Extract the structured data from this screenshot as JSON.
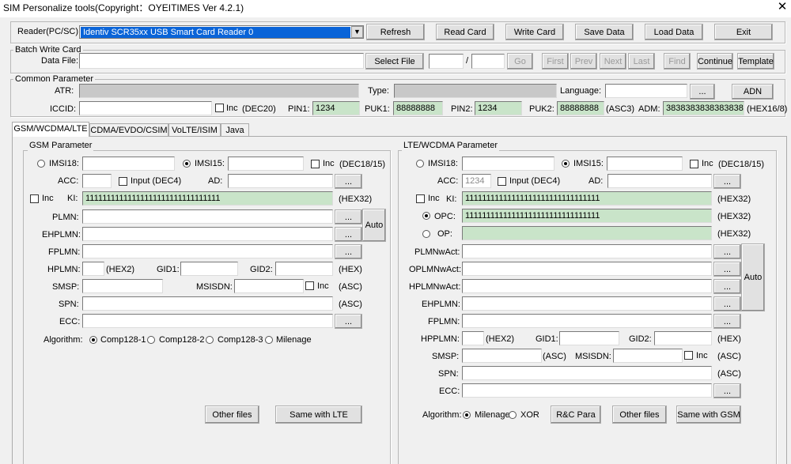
{
  "window": {
    "title": "SIM Personalize tools(Copyright：OYEITIMES Ver 4.2.1)",
    "close_glyph": "✕"
  },
  "reader": {
    "label": "Reader(PC/SC):",
    "selected": "Identiv SCR35xx USB Smart Card Reader 0",
    "dropdown_glyph": "▼"
  },
  "toolbar": {
    "refresh": "Refresh",
    "read_card": "Read Card",
    "write_card": "Write Card",
    "save_data": "Save Data",
    "load_data": "Load Data",
    "exit": "Exit"
  },
  "batch": {
    "group_label": "Batch Write Card",
    "data_file_label": "Data File:",
    "data_file_value": "",
    "select_file": "Select File",
    "page_current": "",
    "page_sep": "/",
    "page_total": "",
    "go": "Go",
    "first": "First",
    "prev": "Prev",
    "next": "Next",
    "last": "Last",
    "find": "Find",
    "continue": "Continue",
    "template": "Template"
  },
  "common": {
    "group_label": "Common Parameter",
    "atr_label": "ATR:",
    "atr_value": "",
    "type_label": "Type:",
    "type_value": "",
    "language_label": "Language:",
    "language_value": "",
    "ellipsis": "...",
    "adn": "ADN",
    "iccid_label": "ICCID:",
    "iccid_value": "",
    "inc_label": "Inc",
    "dec20": "(DEC20)",
    "pin1_label": "PIN1:",
    "pin1_value": "1234",
    "puk1_label": "PUK1:",
    "puk1_value": "88888888",
    "pin2_label": "PIN2:",
    "pin2_value": "1234",
    "puk2_label": "PUK2:",
    "puk2_value": "88888888",
    "asc3": "(ASC3)",
    "adm_label": "ADM:",
    "adm_value": "3838383838383838",
    "hex16_8": "(HEX16/8)"
  },
  "tabs": [
    "GSM/WCDMA/LTE",
    "CDMA/EVDO/CSIM",
    "VoLTE/ISIM",
    "Java"
  ],
  "gsm": {
    "group_label": "GSM Parameter",
    "imsi18_label": "IMSI18:",
    "imsi18_value": "",
    "imsi15_label": "IMSI15:",
    "imsi15_value": "",
    "inc": "Inc",
    "dec18_15": "(DEC18/15)",
    "acc_label": "ACC:",
    "acc_value": "",
    "input_dec4": "Input (DEC4)",
    "ad_label": "AD:",
    "ad_value": "",
    "ki_label": "KI:",
    "ki_value": "11111111111111111111111111111111",
    "hex32": "(HEX32)",
    "plmn_label": "PLMN:",
    "ehplmn_label": "EHPLMN:",
    "fplmn_label": "FPLMN:",
    "auto": "Auto",
    "hplmn_label": "HPLMN:",
    "hex2": "(HEX2)",
    "gid1_label": "GID1:",
    "gid2_label": "GID2:",
    "hex": "(HEX)",
    "smsp_label": "SMSP:",
    "msisdn_label": "MSISDN:",
    "asc": "(ASC)",
    "spn_label": "SPN:",
    "ecc_label": "ECC:",
    "algorithm_label": "Algorithm:",
    "alg1": "Comp128-1",
    "alg2": "Comp128-2",
    "alg3": "Comp128-3",
    "alg4": "Milenage",
    "other_files": "Other files",
    "same_with_lte": "Same with LTE",
    "ellipsis": "..."
  },
  "lte": {
    "group_label": "LTE/WCDMA Parameter",
    "imsi18_label": "IMSI18:",
    "imsi15_label": "IMSI15:",
    "inc": "Inc",
    "dec18_15": "(DEC18/15)",
    "acc_label": "ACC:",
    "acc_value": "1234",
    "input_dec4": "Input (DEC4)",
    "ad_label": "AD:",
    "ki_label": "KI:",
    "ki_value": "11111111111111111111111111111111",
    "hex32": "(HEX32)",
    "opc_label": "OPC:",
    "opc_value": "11111111111111111111111111111111",
    "op_label": "OP:",
    "op_value": "",
    "plmnwact_label": "PLMNwAct:",
    "oplmnwact_label": "OPLMNwAct:",
    "hplmnwact_label": "HPLMNwAct:",
    "ehplmn_label": "EHPLMN:",
    "fplmn_label": "FPLMN:",
    "auto": "Auto",
    "hpplmn_label": "HPPLMN:",
    "hex2": "(HEX2)",
    "gid1_label": "GID1:",
    "gid2_label": "GID2:",
    "hex": "(HEX)",
    "smsp_label": "SMSP:",
    "asc": "(ASC)",
    "msisdn_label": "MSISDN:",
    "spn_label": "SPN:",
    "ecc_label": "ECC:",
    "algorithm_label": "Algorithm:",
    "alg1": "Milenage",
    "alg2": "XOR",
    "rc_para": "R&C Para",
    "other_files": "Other files",
    "same_with_gsm": "Same with GSM",
    "ellipsis": "..."
  }
}
